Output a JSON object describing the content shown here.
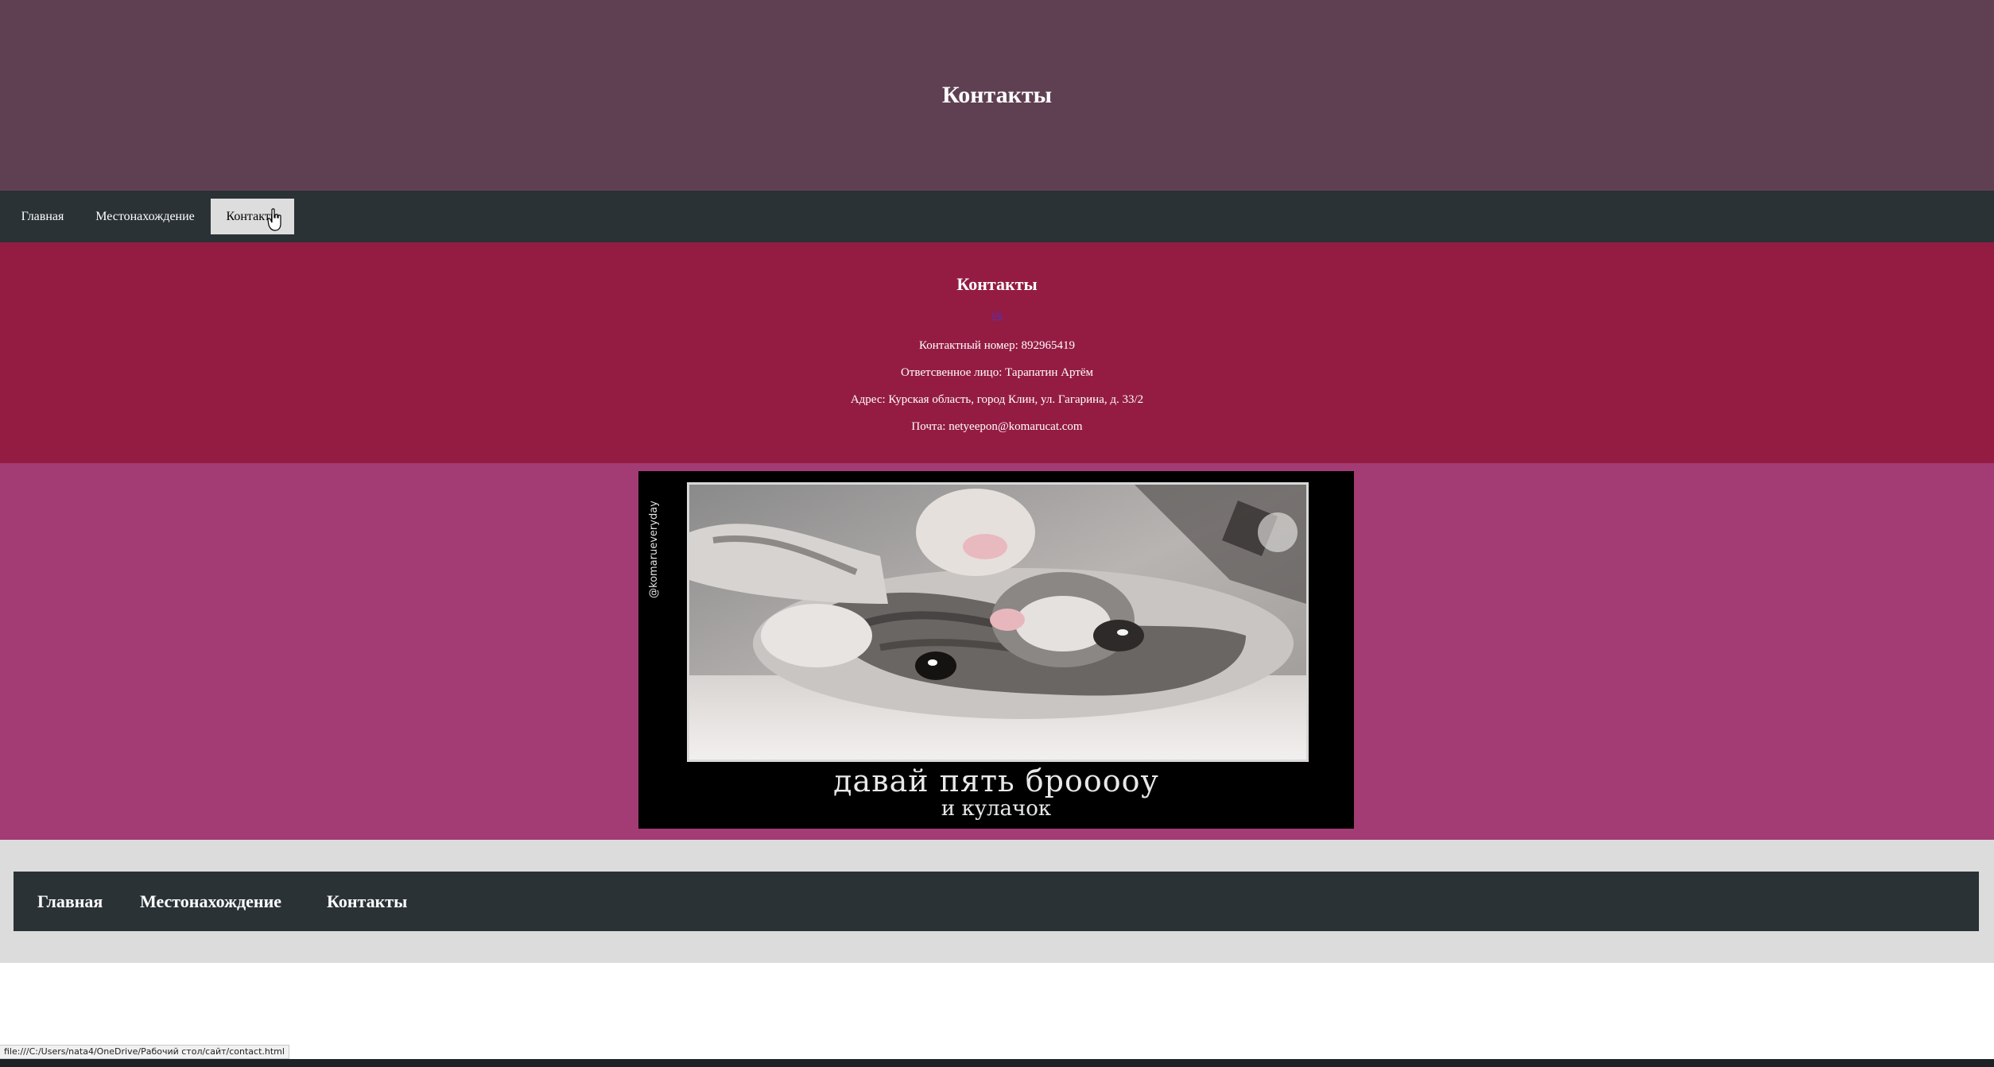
{
  "hero": {
    "title": "Контакты"
  },
  "top_nav": {
    "items": [
      {
        "label": "Главная"
      },
      {
        "label": "Местонахождение"
      },
      {
        "label": "Контакты",
        "active": true
      }
    ]
  },
  "contacts": {
    "heading": "Контакты",
    "vk_link": "vk",
    "phone": "Контактный номер: 892965419",
    "person": "Ответсвенное лицо: Тарапатин Артём",
    "address": "Адрес: Курская область, город Клин, ул. Гагарина, д. 33/2",
    "email": "Почта: netyeepon@komarucat.com"
  },
  "meme": {
    "watermark": "@komarueveryday",
    "caption_line1": "давай пять броооoу",
    "caption_line2": "и кулачок"
  },
  "footer_nav": {
    "items": [
      {
        "label": "Главная"
      },
      {
        "label": "Местонахождение"
      },
      {
        "label": "Контакты"
      }
    ]
  },
  "status_bar": {
    "url": "file:///C:/Users/nata4/OneDrive/Рабочий стол/сайт/contact.html"
  },
  "colors": {
    "hero_bg": "#5f4052",
    "nav_bg": "#2a3236",
    "contacts_bg": "#941c43",
    "image_section_bg": "#a33c75",
    "footer_bg": "#dcdcdc"
  }
}
